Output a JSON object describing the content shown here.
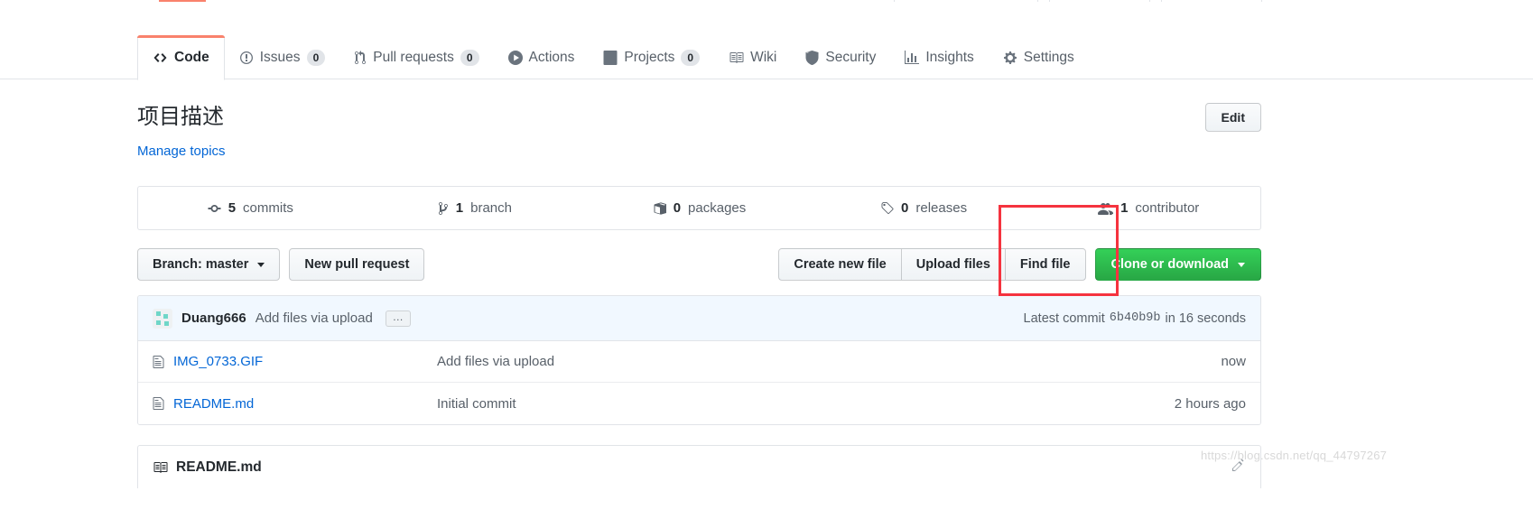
{
  "nav": {
    "tabs": [
      {
        "label": "Code",
        "icon": "code-icon",
        "count": null,
        "active": true
      },
      {
        "label": "Issues",
        "icon": "issue-icon",
        "count": "0",
        "active": false
      },
      {
        "label": "Pull requests",
        "icon": "pr-icon",
        "count": "0",
        "active": false
      },
      {
        "label": "Actions",
        "icon": "play-icon",
        "count": null,
        "active": false
      },
      {
        "label": "Projects",
        "icon": "project-icon",
        "count": "0",
        "active": false
      },
      {
        "label": "Wiki",
        "icon": "book-icon",
        "count": null,
        "active": false
      },
      {
        "label": "Security",
        "icon": "shield-icon",
        "count": null,
        "active": false
      },
      {
        "label": "Insights",
        "icon": "graph-icon",
        "count": null,
        "active": false
      },
      {
        "label": "Settings",
        "icon": "gear-icon",
        "count": null,
        "active": false
      }
    ]
  },
  "about": {
    "description": "项目描述",
    "manage_topics": "Manage topics",
    "edit_label": "Edit"
  },
  "numbers": [
    {
      "value": "5",
      "label": "commits",
      "icon": "commit-icon"
    },
    {
      "value": "1",
      "label": "branch",
      "icon": "branch-icon"
    },
    {
      "value": "0",
      "label": "packages",
      "icon": "package-icon"
    },
    {
      "value": "0",
      "label": "releases",
      "icon": "tag-icon"
    },
    {
      "value": "1",
      "label": "contributor",
      "icon": "people-icon"
    }
  ],
  "actions": {
    "branch_label": "Branch: master",
    "new_pull_request": "New pull request",
    "create_new_file": "Create new file",
    "upload_files": "Upload files",
    "find_file": "Find file",
    "clone_or_download": "Clone or download"
  },
  "commit_bar": {
    "author": "Duang666",
    "message": "Add files via upload",
    "expand_label": "…",
    "latest_prefix": "Latest commit",
    "sha": "6b40b9b",
    "time": "in 16 seconds"
  },
  "files": [
    {
      "name": "IMG_0733.GIF",
      "message": "Add files via upload",
      "time": "now",
      "icon": "file-icon"
    },
    {
      "name": "README.md",
      "message": "Initial commit",
      "time": "2 hours ago",
      "icon": "file-icon"
    }
  ],
  "readme": {
    "title": "README.md",
    "icon": "book-icon",
    "edit_icon": "pencil-icon"
  },
  "watermark": "https://blog.csdn.net/qq_44797267",
  "colors": {
    "accent_orange": "#f9826c",
    "link_blue": "#0366d6",
    "green": "#28a745",
    "annotation_red": "#f5333f"
  },
  "annotation": {
    "shape": "rectangle",
    "color": "#f5333f"
  }
}
